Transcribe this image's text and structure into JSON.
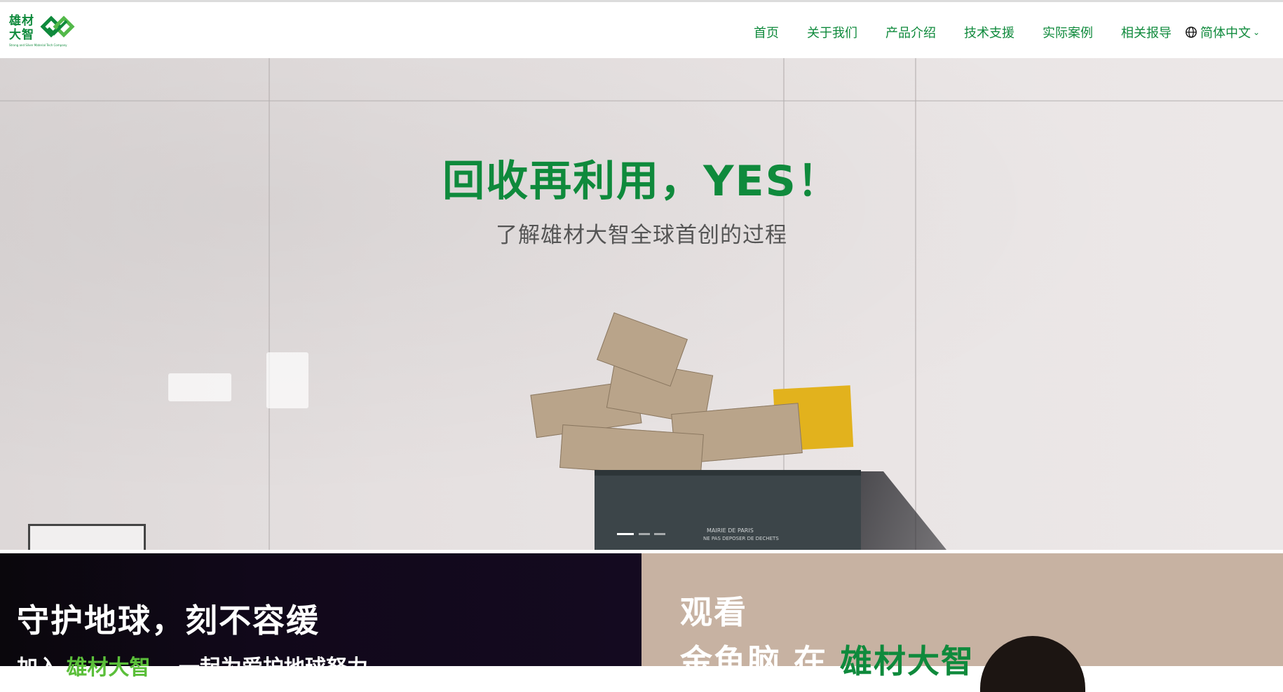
{
  "brand": {
    "logo_text": "雄材大智",
    "logo_tagline": "Strong and Silver Material Tech Company",
    "color": "#0f8a3c"
  },
  "nav": {
    "items": [
      {
        "label": "首页"
      },
      {
        "label": "关于我们"
      },
      {
        "label": "产品介绍"
      },
      {
        "label": "技术支援"
      },
      {
        "label": "实际案例"
      },
      {
        "label": "相关报导"
      }
    ],
    "language": {
      "label": "简体中文",
      "icon": "globe-icon",
      "dropdown_icon": "chevron-down-icon"
    }
  },
  "hero": {
    "title": "回收再利用，YES！",
    "subtitle": "了解雄材大智全球首创的过程",
    "bin_label": "MAIRIE DE PARIS",
    "bin_label2": "NE PAS DEPOSER DE DECHETS",
    "carousel": {
      "slides": 3,
      "active": 1
    }
  },
  "left_section": {
    "title": "守护地球，刻不容缓",
    "sub_prefix": "加入",
    "sub_highlight": "雄材大智",
    "sub_suffix": "，一起为爱护地球努力",
    "background": "#0d0812"
  },
  "right_section": {
    "watch": "观看",
    "line2_prefix": "金鱼脑 在",
    "line2_highlight": "雄材大智",
    "background": "#c7b2a2"
  }
}
